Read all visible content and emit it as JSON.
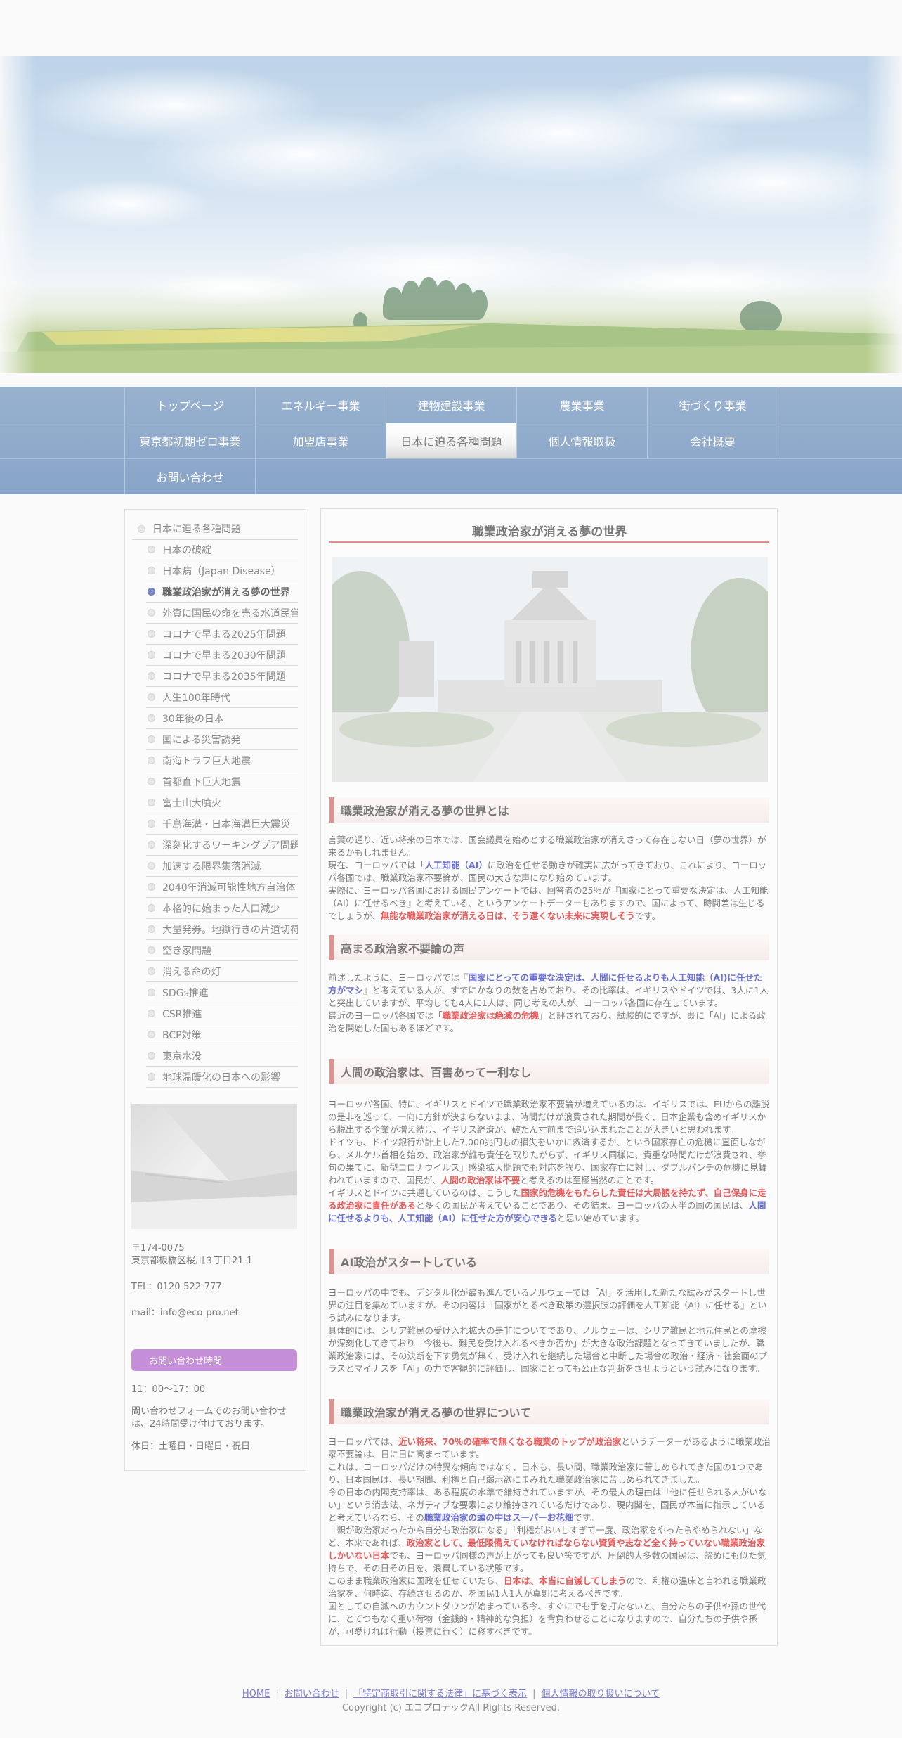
{
  "nav": {
    "row1": [
      "トップページ",
      "エネルギー事業",
      "建物建設事業",
      "農業事業",
      "街づくり事業"
    ],
    "row2": [
      "東京都初期ゼロ事業",
      "加盟店事業",
      "日本に迫る各種問題",
      "個人情報取扱",
      "会社概要"
    ],
    "row3": [
      "お問い合わせ"
    ]
  },
  "sidebar": {
    "heading": "日本に迫る各種問題",
    "items": [
      "日本の破綻",
      "日本病（Japan Disease）",
      "職業政治家が消える夢の世界",
      "外資に国民の命を売る水道民営化",
      "コロナで早まる2025年問題",
      "コロナで早まる2030年問題",
      "コロナで早まる2035年問題",
      "人生100年時代",
      "30年後の日本",
      "国による災害誘発",
      "南海トラフ巨大地震",
      "首都直下巨大地震",
      "富士山大噴火",
      "千島海溝・日本海溝巨大震災",
      "深刻化するワーキングプア問題",
      "加速する限界集落消滅",
      "2040年消滅可能性地方自治体",
      "本格的に始まった人口減少",
      "大量発券。地獄行きの片道切符",
      "空き家問題",
      "消える命の灯",
      "SDGs推進",
      "CSR推進",
      "BCP対策",
      "東京水没",
      "地球温暖化の日本への影響"
    ],
    "postal": "〒174-0075",
    "address": "東京都板橋区桜川３丁目21-1",
    "tel": "TEL：0120-522-777",
    "mail": "mail：info@eco-pro.net",
    "contact_button": "お問い合わせ時間",
    "hours": "11：00～17：00",
    "form_note": "問い合わせフォームでのお問い合わせは、24時間受け付けております。",
    "holiday": "休日：土曜日・日曜日・祝日"
  },
  "main": {
    "title": "職業政治家が消える夢の世界",
    "sections": [
      {
        "heading": "職業政治家が消える夢の世界とは",
        "p1": "言葉の通り、近い将来の日本では、国会議員を始めとする職業政治家が消えさって存在しない日（夢の世界）が来るかもしれません。",
        "p2a": "現在、ヨーロッパでは「",
        "p2b": "人工知能（AI）",
        "p2c": "に政治を任せる動きが確実に広がってきており、これにより、ヨーロッパ各国では、職業政治家不要論が、国民の大きな声になり始めています。",
        "p3a": "実際に、ヨーロッパ各国における国民アンケートでは、回答者の25％が『国家にとって重要な決定は、人工知能（AI）に任せるべき』と考えている、というアンケートデーターもありますので、国によって、時間差は生じるでしょうが、",
        "p3b": "無能な職業政治家が消える日は、そう遠くない未来に実現しそう",
        "p3c": "です。"
      },
      {
        "heading": "高まる政治家不要論の声",
        "p1a": "前述したように、ヨーロッパでは『",
        "p1b": "国家にとっての重要な決定は、人間に任せるよりも人工知能（AI)に任せた方がマシ",
        "p1c": "』と考えている人が、すでにかなりの数を占めており、その比率は、イギリスやドイツでは、3人に1人と突出していますが、平均しても4人に1人は、同じ考えの人が、ヨーロッパ各国に存在しています。",
        "p2a": "最近のヨーロッパ各国では「",
        "p2b": "職業政治家は絶滅の危機",
        "p2c": "」と評されており、試験的にですが、既に「AI」による政治を開始した国もあるほどです。"
      },
      {
        "heading": "人間の政治家は、百害あって一利なし",
        "p1": "ヨーロッパ各国、特に、イギリスとドイツで職業政治家不要論が増えているのは、イギリスでは、EUからの離脱の是非を巡って、一向に方針が決まらないまま、時間だけが浪費された期間が長く、日本企業も含めイギリスから脱出する企業が増え続け、イギリス経済が、破たん寸前まで追い込まれたことが大きいと思われます。",
        "p2a": "ドイツも、ドイツ銀行が計上した7,000兆円もの損失をいかに救済するか、という国家存亡の危機に直面しながら、メルケル首相を始め、政治家が誰も責任を取りたがらず、イギリス同様に、貴重な時間だけが浪費され、挙句の果てに、新型コロナウイルス」感染拡大問題でも対応を誤り、国家存亡に対し、ダブルパンチの危機に見舞われていますので、国民が、",
        "p2b": "人間の政治家は不要",
        "p2c": "と考えるのは至極当然のことです。",
        "p3a": "イギリスとドイツに共通しているのは、こうした",
        "p3b": "国家的危機をもたらした責任は大局観を持たず、自己保身に走る政治家に責任がある",
        "p3c": "と多くの国民が考えていることであり、その結果、ヨーロッパの大半の国の国民は、",
        "p3d": "人間に任せるよりも、人工知能（AI）に任せた方が安心できる",
        "p3e": "と思い始めています。"
      },
      {
        "heading": "AI政治がスタートしている",
        "p1": "ヨーロッパの中でも、デジタル化が最も進んでいるノルウェーでは「AI」を活用した新たな試みがスタートし世界の注目を集めていますが、その内容は「国家がとるべき政策の選択肢の評価を人工知能（AI）に任せる」という試みになります。",
        "p2": "具体的には、シリア難民の受け入れ拡大の是非についてであり、ノルウェーは、シリア難民と地元住民との摩擦が深刻化してきており「今後も、難民を受け入れるべきか否か」が大きな政治課題となってきていましたが、職業政治家には、その決断を下す勇気が無く、受け入れを継続した場合と中断した場合の政治・経済・社会面のプラスとマイナスを「AI」の力で客観的に評価し、国家にとっても公正な判断をさせようという試みになります。"
      },
      {
        "heading": "職業政治家が消える夢の世界について",
        "p1a": "ヨーロッパでは、",
        "p1b": "近い将来、70％の確率で無くなる職業のトップが政治家",
        "p1c": "というデーターがあるように職業政治家不要論は、日に日に高まっています。",
        "p2": "これは、ヨーロッパだけの特異な傾向ではなく、日本も、長い間、職業政治家に苦しめられてきた国の1つであり、日本国民は、長い期間、利権と自己弱示欲にまみれた職業政治家に苦しめられてきました。",
        "p3a": "今の日本の内閣支持率は、ある程度の水準で維持されていますが、その最大の理由は「他に任せられる人がいない」という消去法、ネガティブな要素により維持されているだけであり、現内閣を、国民が本当に指示していると考えているなら、その",
        "p3b": "職業政治家の頭の中はスーパーお花畑",
        "p3c": "です。",
        "p4a": "「親が政治家だったから自分も政治家になる」「利権がおいしすぎて一度、政治家をやったらやめられない」など、本来であれば、",
        "p4b": "政治家として、最低限備えていなければならない資質や志など全く持っていない職業政治家しかいない日本",
        "p4c": "でも、ヨーロッパ同様の声が上がっても良い筈ですが、圧倒的大多数の国民は、諦めにも似た気持ちで、その日その日を、浪費している状態です。",
        "p5a": "このまま職業政治家に国政を任せていたら、",
        "p5b": "日本は、本当に自滅してしまう",
        "p5c": "ので、利権の温床と言われる職業政治家を、何時迄、存続させるのか、を国民1人1人が真剣に考えるべきです。",
        "p6": "国としての自滅へのカウントダウンが始まっている今、すぐにでも手を打たないと、自分たちの子供や孫の世代に、とてつもなく重い荷物（金銭的・精神的な負担）を背負わせることになりますので、自分たちの子供や孫が、可愛ければ行動（投票に行く）に移すべきです。"
      }
    ]
  },
  "footer": {
    "links": [
      "HOME",
      "お問い合わせ",
      "「特定商取引に関する法律」に基づく表示",
      "個人情報の取り扱いについて"
    ],
    "separator": "|",
    "copyright": "Copyright (c) エコプロテックAll Rights Reserved."
  }
}
